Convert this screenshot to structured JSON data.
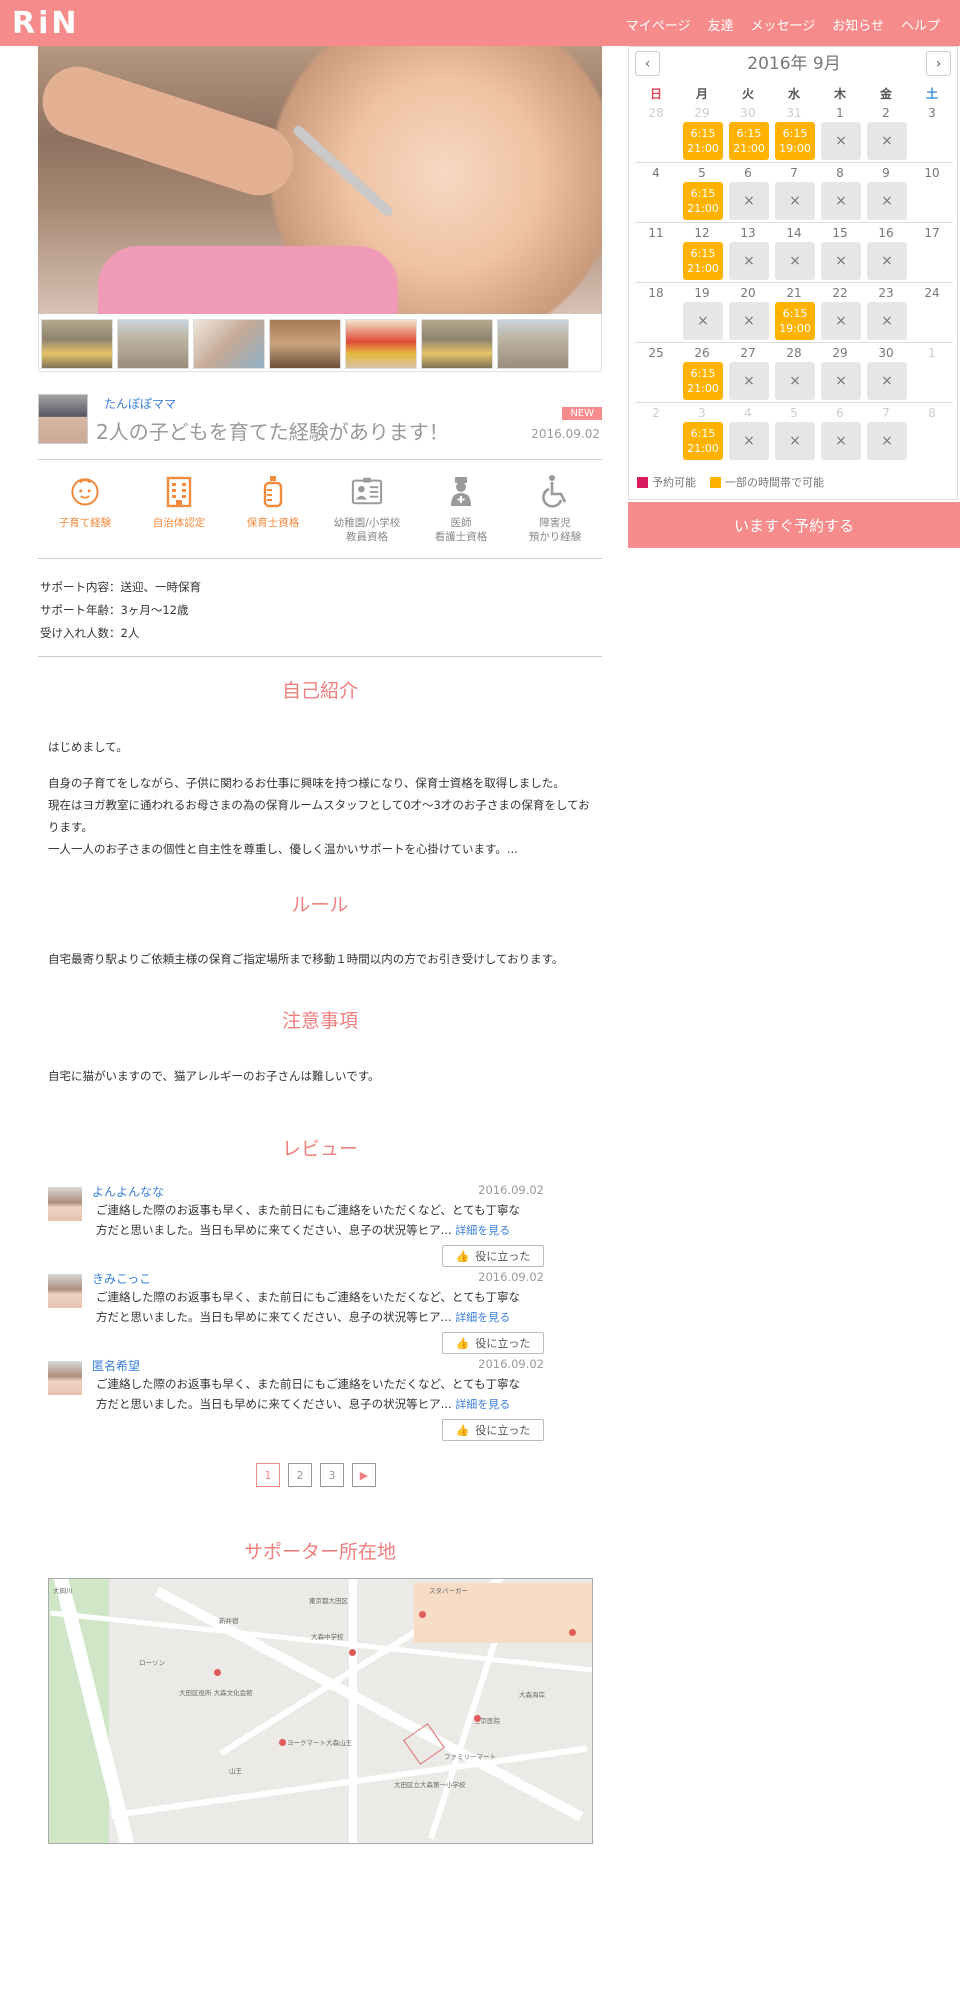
{
  "header": {
    "logo": "RiN",
    "nav": [
      "マイページ",
      "友達",
      "メッセージ",
      "お知らせ",
      "ヘルプ"
    ]
  },
  "profile": {
    "author": "たんぽぽママ",
    "headline": "2人の子どもを育てた経験があります！",
    "badge": "NEW",
    "date": "2016.09.02"
  },
  "qualifications": [
    {
      "label": "子育て経験",
      "icon": "baby-face-icon",
      "active": true
    },
    {
      "label": "自治体認定",
      "icon": "building-icon",
      "active": true
    },
    {
      "label": "保育士資格",
      "icon": "baby-bottle-icon",
      "active": true
    },
    {
      "label": "幼稚園/小学校\n教員資格",
      "icon": "id-card-icon",
      "active": false
    },
    {
      "label": "医師\n看護士資格",
      "icon": "nurse-icon",
      "active": false
    },
    {
      "label": "障害児\n預かり経験",
      "icon": "wheelchair-icon",
      "active": false
    }
  ],
  "info": {
    "support": "サポート内容：送迎、一時保育",
    "age": "サポート年齢：3ヶ月〜12歳",
    "capacity": "受け入れ人数：2人"
  },
  "intro": {
    "title": "自己紹介",
    "p1": "はじめまして。",
    "p2": "自身の子育てをしながら、子供に関わるお仕事に興味を持つ様になり、保育士資格を取得しました。",
    "p3": "現在はヨガ教室に通われるお母さまの為の保育ルームスタッフとして0才〜3才のお子さまの保育をしております。",
    "p4": "一人一人のお子さまの個性と自主性を尊重し、優しく温かいサポートを心掛けています。..."
  },
  "rules": {
    "title": "ルール",
    "text": "自宅最寄り駅よりご依頼主様の保育ご指定場所まで移動１時間以内の方でお引き受けしております。"
  },
  "notes": {
    "title": "注意事項",
    "text": "自宅に猫がいますので、猫アレルギーのお子さんは難しいです。"
  },
  "reviews": {
    "title": "レビュー",
    "more": "詳細を見る",
    "helpful": "役に立った",
    "items": [
      {
        "name": "よんよんなな",
        "date": "2016.09.02",
        "line1": "ご連絡した際のお返事も早く、また前日にもご連絡をいただくなど、とても丁寧な",
        "line2": "方だと思いました。当日も早めに来てください、息子の状況等ヒア..."
      },
      {
        "name": "きみこっこ",
        "date": "2016.09.02",
        "line1": "ご連絡した際のお返事も早く、また前日にもご連絡をいただくなど、とても丁寧な",
        "line2": "方だと思いました。当日も早めに来てください、息子の状況等ヒア..."
      },
      {
        "name": "匿名希望",
        "date": "2016.09.02",
        "line1": "ご連絡した際のお返事も早く、また前日にもご連絡をいただくなど、とても丁寧な",
        "line2": "方だと思いました。当日も早めに来てください、息子の状況等ヒア..."
      }
    ]
  },
  "pager": {
    "pages": [
      "1",
      "2",
      "3"
    ],
    "next": "▶"
  },
  "location": {
    "title": "サポーター所在地",
    "map_labels": [
      "大岡川",
      "東京都大田区",
      "大森中学校",
      "ローソン",
      "大田区役所 大森文化会館",
      "ヨークマート大森山王",
      "スタバーガー",
      "ファミリーマート",
      "大田区立大森第一小学校",
      "三京医院",
      "新井宿",
      "山王",
      "大森海岸"
    ]
  },
  "calendar": {
    "title": "2016年 9月",
    "prev": "‹",
    "next": "›",
    "dow": [
      "日",
      "月",
      "火",
      "水",
      "木",
      "金",
      "土"
    ],
    "weeks": [
      [
        {
          "d": "28",
          "g": true
        },
        {
          "d": "29",
          "g": true,
          "s": [
            "6:15",
            "21:00"
          ]
        },
        {
          "d": "30",
          "g": true,
          "s": [
            "6:15",
            "21:00"
          ]
        },
        {
          "d": "31",
          "g": true,
          "s": [
            "6:15",
            "19:00"
          ]
        },
        {
          "d": "1",
          "x": true
        },
        {
          "d": "2",
          "x": true
        },
        {
          "d": "3"
        }
      ],
      [
        {
          "d": "4"
        },
        {
          "d": "5",
          "s": [
            "6:15",
            "21:00"
          ]
        },
        {
          "d": "6",
          "x": true
        },
        {
          "d": "7",
          "x": true
        },
        {
          "d": "8",
          "x": true
        },
        {
          "d": "9",
          "x": true
        },
        {
          "d": "10"
        }
      ],
      [
        {
          "d": "11"
        },
        {
          "d": "12",
          "s": [
            "6:15",
            "21:00"
          ]
        },
        {
          "d": "13",
          "x": true
        },
        {
          "d": "14",
          "x": true
        },
        {
          "d": "15",
          "x": true
        },
        {
          "d": "16",
          "x": true
        },
        {
          "d": "17"
        }
      ],
      [
        {
          "d": "18"
        },
        {
          "d": "19",
          "x": true
        },
        {
          "d": "20",
          "x": true
        },
        {
          "d": "21",
          "s": [
            "6:15",
            "19:00"
          ]
        },
        {
          "d": "22",
          "x": true
        },
        {
          "d": "23",
          "x": true
        },
        {
          "d": "24"
        }
      ],
      [
        {
          "d": "25"
        },
        {
          "d": "26",
          "s": [
            "6:15",
            "21:00"
          ]
        },
        {
          "d": "27",
          "x": true
        },
        {
          "d": "28",
          "x": true
        },
        {
          "d": "29",
          "x": true
        },
        {
          "d": "30",
          "x": true
        },
        {
          "d": "1",
          "g": true
        }
      ],
      [
        {
          "d": "2",
          "g": true
        },
        {
          "d": "3",
          "g": true,
          "s": [
            "6:15",
            "21:00"
          ]
        },
        {
          "d": "4",
          "g": true,
          "x": true
        },
        {
          "d": "5",
          "g": true,
          "x": true
        },
        {
          "d": "6",
          "g": true,
          "x": true
        },
        {
          "d": "7",
          "g": true,
          "x": true
        },
        {
          "d": "8",
          "g": true
        }
      ]
    ],
    "full_mark": "×",
    "legend_available": "予約可能",
    "legend_partial": "一部の時間帯で可能",
    "colors": {
      "available": "#d81b60",
      "partial": "#ffb300",
      "sunday": "#e0455a",
      "saturday": "#3b8fd6"
    }
  },
  "book_button": "いますぐ予約する",
  "accent": "#f68b8b"
}
